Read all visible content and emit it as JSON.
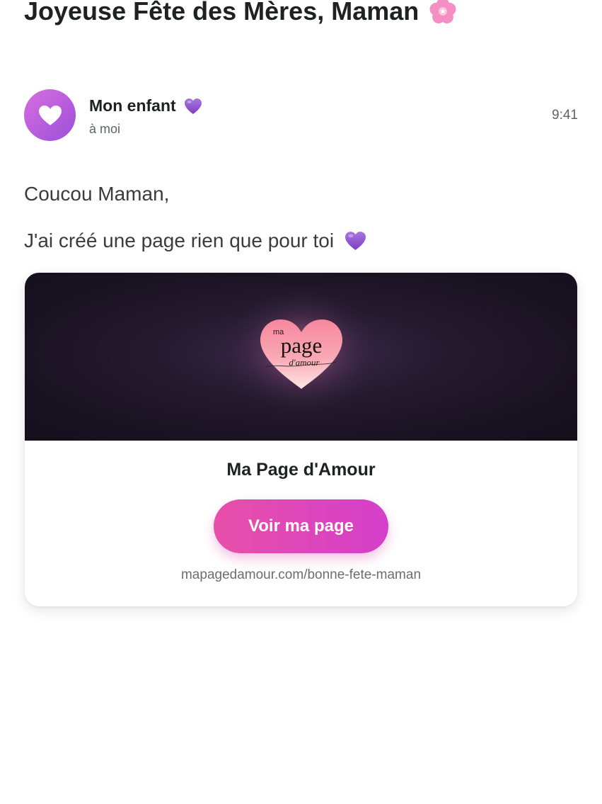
{
  "email": {
    "subject": "Joyeuse Fête des Mères, Maman",
    "subject_icon": "cherry-blossom-emoji",
    "sender": {
      "name": "Mon enfant",
      "name_icon": "purple-heart-emoji",
      "recipient": "à moi",
      "time": "9:41",
      "avatar_icon": "white-heart-icon"
    },
    "body": {
      "greeting": "Coucou Maman,",
      "message": "J'ai créé une page rien que pour toi",
      "message_icon": "purple-heart-emoji"
    },
    "card": {
      "logo": {
        "word_top": "ma",
        "word_main": "page",
        "word_script": "d'amour"
      },
      "title": "Ma Page d'Amour",
      "button_label": "Voir ma page",
      "url": "mapagedamour.com/bonne-fete-maman"
    }
  },
  "colors": {
    "accent_pink": "#e84fa8",
    "accent_magenta": "#d43fca",
    "avatar_purple": "#b05ee0",
    "banner_dark": "#1a1322",
    "heart_pink": "#f7a3b4",
    "purple_heart": "#9b59d0",
    "flower_pink": "#f48fc4"
  }
}
